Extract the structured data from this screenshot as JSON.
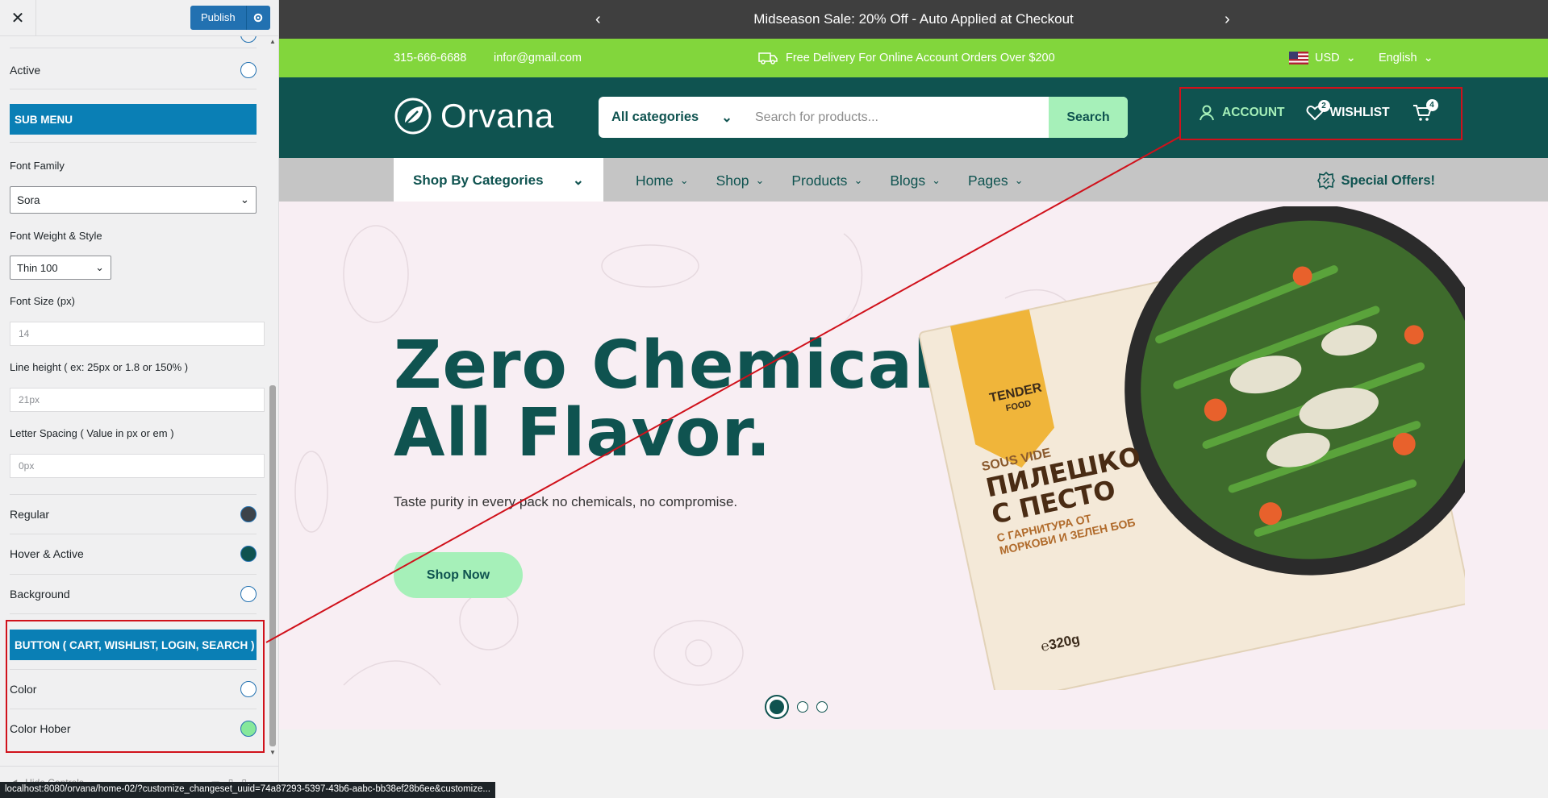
{
  "customizer": {
    "publish_label": "Publish",
    "active_label": "Active",
    "submenu_heading": "SUB MENU",
    "font_family_label": "Font Family",
    "font_family_value": "Sora",
    "font_weight_label": "Font Weight & Style",
    "font_weight_value": "Thin 100",
    "font_size_label": "Font Size (px)",
    "font_size_placeholder": "14",
    "line_height_label": "Line height ( ex: 25px or 1.8 or 150% )",
    "line_height_placeholder": "21px",
    "letter_spacing_label": "Letter Spacing ( Value in px or em )",
    "letter_spacing_placeholder": "0px",
    "regular_label": "Regular",
    "hover_active_label": "Hover & Active",
    "background_label": "Background",
    "button_heading": "BUTTON ( CART, WISHLIST, LOGIN, SEARCH )",
    "color_label": "Color",
    "color_hober_label": "Color Hober",
    "hide_controls_label": "Hide Controls",
    "swatches": {
      "active": "#ffffff",
      "regular": "#3c434a",
      "hover_active": "#0f5350",
      "background": "#ffffff",
      "color": "#ffffff",
      "color_hober": "#86e89b"
    }
  },
  "site": {
    "promo_text": "Midseason Sale: 20% Off - Auto Applied at Checkout",
    "phone": "315-666-6688",
    "email": "infor@gmail.com",
    "delivery_text": "Free Delivery For Online Account Orders Over $200",
    "currency": "USD",
    "language": "English",
    "logo_text": "Orvana",
    "search_category": "All categories",
    "search_placeholder": "Search for products...",
    "search_button": "Search",
    "account_label": "ACCOUNT",
    "wishlist_label": "WISHLIST",
    "wishlist_count": "2",
    "cart_count": "4",
    "shop_by_categories": "Shop By Categories",
    "nav": [
      "Home",
      "Shop",
      "Products",
      "Blogs",
      "Pages"
    ],
    "special_offers": "Special Offers!",
    "hero_line1": "Zero Chemicals.",
    "hero_line2": "All Flavor.",
    "hero_subtitle": "Taste purity in every pack no chemicals, no compromise.",
    "hero_cta": "Shop Now",
    "product_brand_top": "TENDER",
    "product_brand_bottom": "FOOD",
    "product_sous_vide": "SOUS VIDE",
    "product_title_1": "ПИЛЕШКО",
    "product_title_2": "С ПЕСТО",
    "product_subtitle_1": "С ГАРНИТУРА ОТ",
    "product_subtitle_2": "МОРКОВИ И ЗЕЛЕН БОБ",
    "product_weight": "℮320g"
  },
  "status_url": "localhost:8080/orvana/home-02/?customize_changeset_uuid=74a87293-5397-43b6-aabc-bb38ef28b6ee&customize..."
}
